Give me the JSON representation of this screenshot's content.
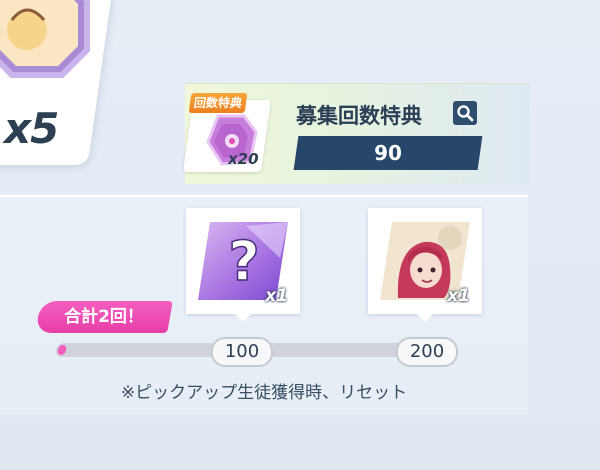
{
  "left_card": {
    "multiplier": "x5"
  },
  "bonus": {
    "badge": "回数特典",
    "item_qty": "x20",
    "title": "募集回数特典",
    "count": "90",
    "search_icon": "search-icon"
  },
  "rewards": [
    {
      "qty": "x1",
      "art": "mystery-question-mark",
      "milestone": "100"
    },
    {
      "qty": "x1",
      "art": "student-portrait",
      "milestone": "200"
    }
  ],
  "progress": {
    "total_label": "合計2回！",
    "current": 2,
    "max": 200
  },
  "note": "※ピックアップ生徒獲得時、リセット",
  "colors": {
    "accent_pink": "#f25fbe",
    "navy": "#27476a",
    "badge_orange": "#ee7f1e"
  }
}
